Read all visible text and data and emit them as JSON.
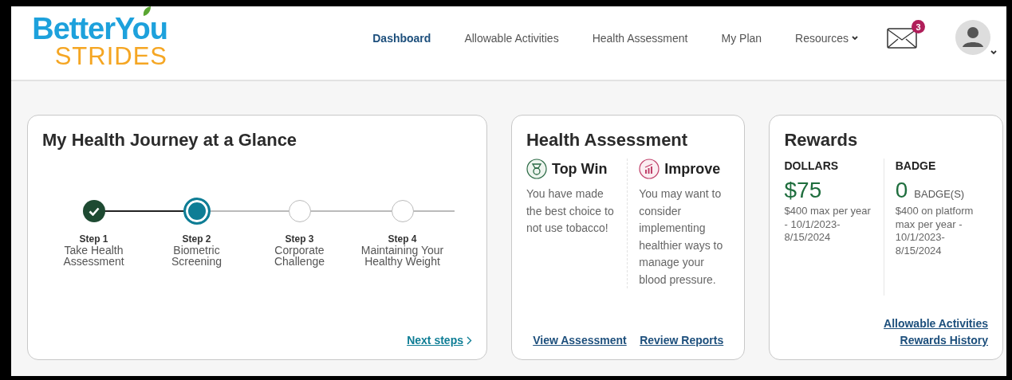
{
  "logo": {
    "line1": "BetterYou",
    "line2": "STRIDES"
  },
  "nav": [
    {
      "label": "Dashboard",
      "selected": true
    },
    {
      "label": "Allowable Activities",
      "selected": false
    },
    {
      "label": "Health Assessment",
      "selected": false
    },
    {
      "label": "My Plan",
      "selected": false
    },
    {
      "label": "Resources",
      "selected": false,
      "dropdown": true
    }
  ],
  "messages": {
    "count": "3"
  },
  "journey": {
    "title": "My Health Journey at a Glance",
    "steps": [
      {
        "step": "Step 1",
        "label": "Take Health Assessment",
        "completed": true,
        "selected": false
      },
      {
        "step": "Step 2",
        "label": "Biometric Screening",
        "completed": false,
        "selected": true
      },
      {
        "step": "Step 3",
        "label": "Corporate Challenge",
        "completed": false,
        "selected": false
      },
      {
        "step": "Step 4",
        "label": "Maintaining Your Healthy Weight",
        "completed": false,
        "selected": false
      }
    ],
    "link": "Next steps"
  },
  "assessment": {
    "title": "Health Assessment",
    "columns": [
      {
        "kind": "win",
        "heading": "Top Win",
        "text": "You have made the best choice to not use tobacco!"
      },
      {
        "kind": "improve",
        "heading": "Improve",
        "text": "You may want to consider implementing healthier ways to manage your blood pressure."
      }
    ],
    "links": [
      "View Assessment",
      "Review Reports"
    ]
  },
  "rewards": {
    "title": "Rewards",
    "columns": [
      {
        "heading": "DOLLARS",
        "amount": "$75",
        "text": "$400 max per year - 10/1/2023-8/15/2024"
      },
      {
        "heading": "BADGE",
        "amount": "0",
        "unit": "BADGE(S)",
        "text": "$400 on platform max per year - 10/1/2023-8/15/2024"
      }
    ],
    "links": [
      "Allowable Activities",
      "Rewards History"
    ]
  }
}
